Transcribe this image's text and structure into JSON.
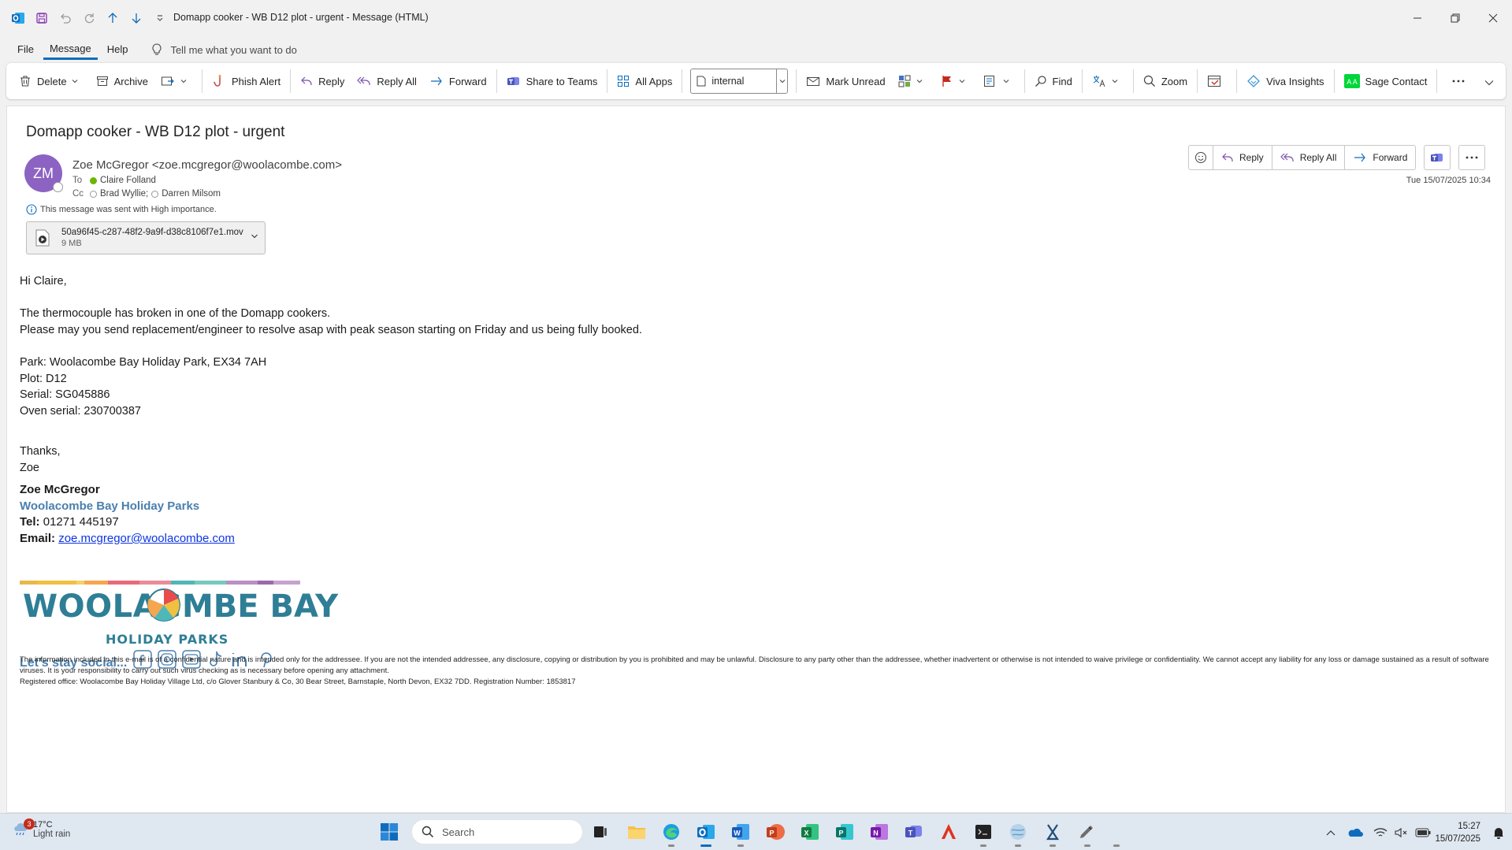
{
  "window": {
    "title": "Domapp cooker - WB D12 plot - urgent  -  Message (HTML)"
  },
  "menu": {
    "file": "File",
    "message": "Message",
    "help": "Help",
    "tell_me": "Tell me what you want to do"
  },
  "ribbon": {
    "delete": "Delete",
    "archive": "Archive",
    "phish_alert": "Phish Alert",
    "reply": "Reply",
    "reply_all": "Reply All",
    "forward": "Forward",
    "share_to_teams": "Share to Teams",
    "all_apps": "All Apps",
    "tag_value": "internal",
    "mark_unread": "Mark Unread",
    "find": "Find",
    "zoom": "Zoom",
    "viva_insights": "Viva Insights",
    "sage_contact": "Sage Contact"
  },
  "message": {
    "subject": "Domapp cooker - WB D12 plot - urgent",
    "avatar_initials": "ZM",
    "sender": "Zoe McGregor <zoe.mcgregor@woolacombe.com>",
    "to_label": "To",
    "to": "Claire Folland",
    "cc_label": "Cc",
    "cc": [
      "Brad Wyllie;",
      "Darren Milsom"
    ],
    "importance": "This message was sent with High importance.",
    "date": "Tue 15/07/2025 10:34",
    "attachment": {
      "name": "50a96f45-c287-48f2-9a9f-d38c8106f7e1.mov",
      "size": "9 MB"
    },
    "actions": {
      "reply": "Reply",
      "reply_all": "Reply All",
      "forward": "Forward"
    }
  },
  "body": {
    "greeting": "Hi Claire,",
    "line1": "The thermocouple has broken in one of the Domapp cookers.",
    "line2": "Please may you send replacement/engineer to resolve asap with peak season starting on Friday and us being fully booked.",
    "park": "Park: Woolacombe Bay Holiday Park, EX34 7AH",
    "plot": "Plot: D12",
    "serial": "Serial: SG045886",
    "oven_serial": "Oven serial: 230700387",
    "thanks": "Thanks,",
    "sign": "Zoe"
  },
  "signature": {
    "name": "Zoe McGregor",
    "company": "Woolacombe Bay Holiday Parks",
    "tel_label": "Tel:",
    "tel": " 01271 445197",
    "email_label": "Email:",
    "email": "zoe.mcgregor@woolacombe.com",
    "logo_text": "WOOLACOMBE BAY",
    "logo_sub": "HOLIDAY PARKS",
    "social_text": "Let's stay social...",
    "disclaimer1": "The information included in this e-mail is of a confidential nature and is intended only for the addressee. If you are not the intended addressee, any disclosure, copying or distribution by you is prohibited and may be unlawful. Disclosure to any party other than the addressee, whether inadvertent or otherwise is not intended to waive privilege or confidentiality. We cannot accept any liability for any loss or damage sustained as a result of software viruses. It is your responsibility to carry out such virus checking as is necessary before opening any attachment.",
    "disclaimer2": "Registered office: Woolacombe Bay Holiday Village Ltd, c/o Glover Stanbury & Co, 30 Bear Street, Barnstaple, North Devon, EX32 7DD. Registration Number: 1853817"
  },
  "taskbar": {
    "weather_temp": "17°C",
    "weather_cond": "Light rain",
    "weather_badge": "3",
    "search_placeholder": "Search",
    "time": "15:27",
    "date": "15/07/2025"
  },
  "colors": {
    "accent": "#0f6cbd",
    "avatar": "#8c63c2",
    "signature_blue": "#4a7fae",
    "logo_blue": "#2e7e96"
  }
}
